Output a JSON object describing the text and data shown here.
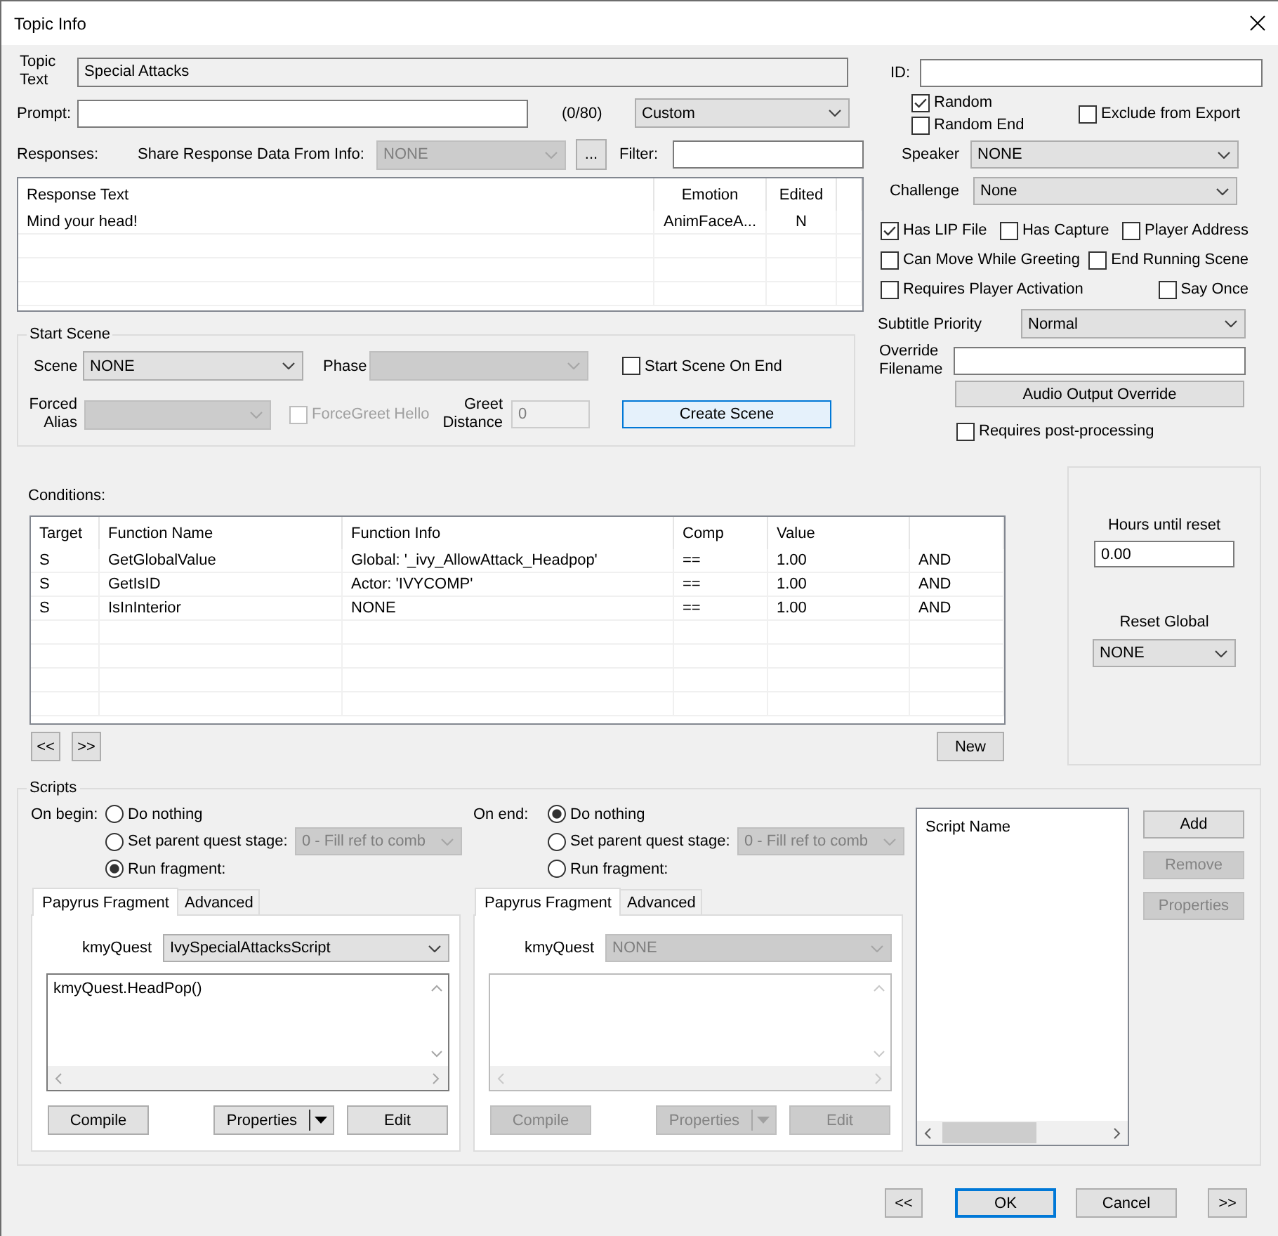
{
  "window": {
    "title": "Topic Info"
  },
  "topic_text": {
    "label": "Topic Text",
    "value": "Special Attacks"
  },
  "prompt": {
    "label": "Prompt:",
    "counter": "(0/80)",
    "type": {
      "value": "Custom",
      "disabled": false
    }
  },
  "responses": {
    "label": "Responses:",
    "share_label": "Share Response Data From Info:",
    "share": {
      "value": "NONE",
      "disabled": true
    },
    "browse_button": "...",
    "filter_label": "Filter:",
    "columns": [
      "Response Text",
      "Emotion",
      "Edited"
    ],
    "rows": [
      [
        "Mind your head!",
        "AnimFaceA...",
        "N"
      ]
    ]
  },
  "start_scene": {
    "title": "Start Scene",
    "scene": {
      "label": "Scene",
      "value": "NONE",
      "disabled": false
    },
    "phase": {
      "label": "Phase",
      "disabled": true
    },
    "start_on_end": {
      "label": "Start Scene On End",
      "checked": false,
      "disabled": false
    },
    "forced_alias": {
      "label": "Forced Alias",
      "disabled": true
    },
    "force_greet": {
      "label": "ForceGreet Hello",
      "checked": false,
      "disabled": true
    },
    "greet_distance": {
      "label": "Greet Distance",
      "value": "0",
      "disabled": true
    },
    "create_button": {
      "label": "Create Scene",
      "disabled": false,
      "highlighted": true
    }
  },
  "info": {
    "id_label": "ID:",
    "random": [
      {
        "label": "Random",
        "checked": true
      },
      {
        "label": "Random End",
        "checked": false
      }
    ],
    "exclude": {
      "label": "Exclude from Export",
      "checked": false
    },
    "speaker": {
      "label": "Speaker",
      "value": "NONE",
      "disabled": false
    },
    "challenge": {
      "label": "Challenge",
      "value": "None",
      "disabled": false
    },
    "flags": [
      [
        {
          "label": "Has LIP File",
          "checked": true
        },
        {
          "label": "Has Capture",
          "checked": false
        },
        {
          "label": "Player Address",
          "checked": false
        }
      ],
      [
        {
          "label": "Can Move While Greeting",
          "checked": false
        },
        {
          "label": "End Running Scene",
          "checked": false
        }
      ],
      [
        {
          "label": "Requires Player Activation",
          "checked": false
        },
        {
          "label": "Say Once",
          "checked": false
        }
      ]
    ],
    "subtitle_priority": {
      "label": "Subtitle Priority",
      "value": "Normal",
      "disabled": false
    },
    "override_filename": {
      "label": "Override Filename"
    },
    "audio_button": {
      "label": "Audio Output Override",
      "disabled": false
    },
    "post_processing": {
      "label": "Requires post-processing",
      "checked": false
    }
  },
  "conditions": {
    "label": "Conditions:",
    "columns": [
      "Target",
      "Function Name",
      "Function Info",
      "Comp",
      "Value"
    ],
    "rows": [
      [
        "S",
        "GetGlobalValue",
        "Global: '_ivy_AllowAttack_Headpop'",
        "==",
        "1.00",
        "AND"
      ],
      [
        "S",
        "GetIsID",
        "Actor: 'IVYCOMP'",
        "==",
        "1.00",
        "AND"
      ],
      [
        "S",
        "IsInInterior",
        "NONE",
        "==",
        "1.00",
        "AND"
      ]
    ],
    "prev_button": "<<",
    "next_button": ">>",
    "new_button": "New"
  },
  "reset": {
    "hours_label": "Hours until reset",
    "hours_value": "0.00",
    "global_label": "Reset Global",
    "global": {
      "value": "NONE",
      "disabled": false
    }
  },
  "scripts": {
    "title": "Scripts",
    "sides": [
      {
        "label": "On begin:",
        "options": [
          {
            "label": "Do nothing",
            "selected": false
          },
          {
            "label": "Set parent quest stage:",
            "selected": false,
            "stage": {
              "value": "0 - Fill ref to comb",
              "disabled": true
            }
          },
          {
            "label": "Run fragment:",
            "selected": true
          }
        ],
        "tabs": [
          {
            "label": "Papyrus Fragment",
            "selected": true
          },
          {
            "label": "Advanced",
            "selected": false
          }
        ],
        "kmyquest": {
          "label": "kmyQuest",
          "value": "IvySpecialAttacksScript",
          "disabled": false
        },
        "editor": {
          "code": "kmyQuest.HeadPop()",
          "disabled": false
        },
        "buttons": [
          {
            "label": "Compile",
            "kind": "plain",
            "disabled": false
          },
          {
            "label": "Properties",
            "kind": "split",
            "disabled": false
          },
          {
            "label": "Edit",
            "kind": "plain",
            "disabled": false
          }
        ]
      },
      {
        "label": "On end:",
        "options": [
          {
            "label": "Do nothing",
            "selected": true
          },
          {
            "label": "Set parent quest stage:",
            "selected": false,
            "stage": {
              "value": "0 - Fill ref to comb",
              "disabled": true
            }
          },
          {
            "label": "Run fragment:",
            "selected": false
          }
        ],
        "tabs": [
          {
            "label": "Papyrus Fragment",
            "selected": true
          },
          {
            "label": "Advanced",
            "selected": false
          }
        ],
        "kmyquest": {
          "label": "kmyQuest",
          "value": "NONE",
          "disabled": true
        },
        "editor": {
          "disabled": true
        },
        "buttons": [
          {
            "label": "Compile",
            "kind": "plain",
            "disabled": true
          },
          {
            "label": "Properties",
            "kind": "split",
            "disabled": true
          },
          {
            "label": "Edit",
            "kind": "plain",
            "disabled": true
          }
        ]
      }
    ],
    "list_header": "Script Name",
    "list_buttons": [
      {
        "label": "Add",
        "disabled": false
      },
      {
        "label": "Remove",
        "disabled": true
      },
      {
        "label": "Properties",
        "disabled": true
      }
    ]
  },
  "footer_buttons": [
    {
      "label": "<<",
      "default": false
    },
    {
      "label": "OK",
      "default": true
    },
    {
      "label": "Cancel",
      "default": false
    },
    {
      "label": ">>",
      "default": false
    }
  ]
}
